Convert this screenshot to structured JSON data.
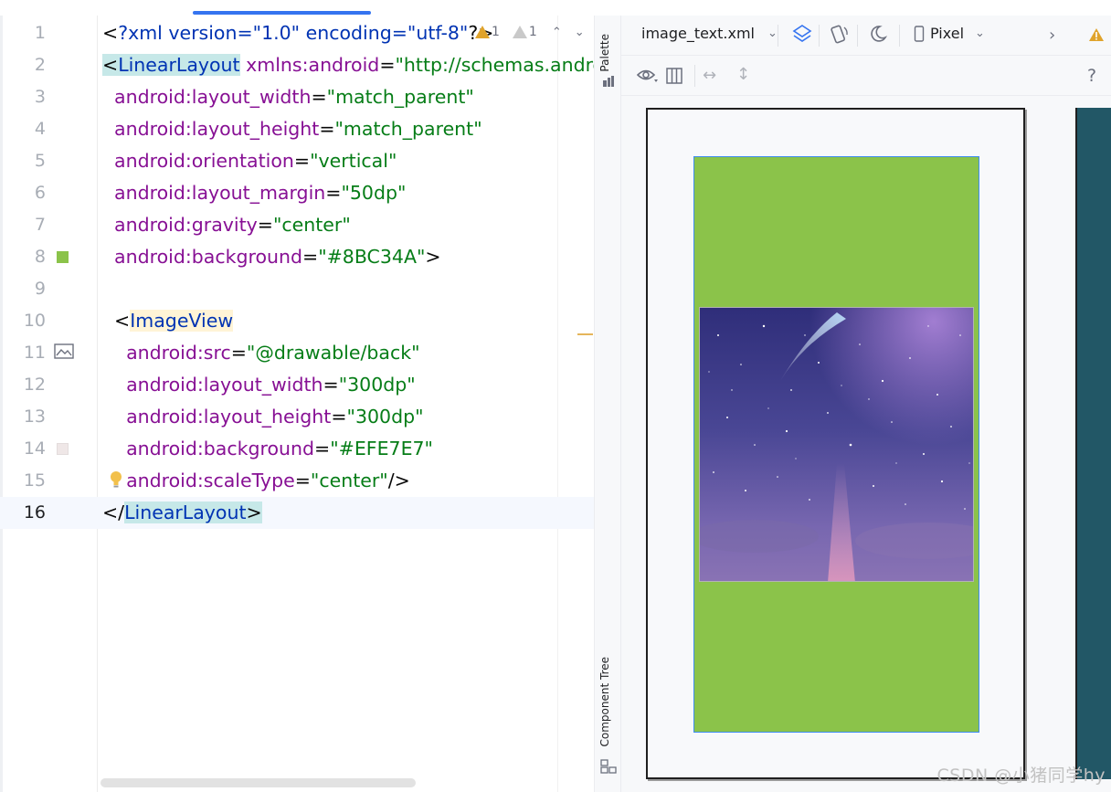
{
  "editor": {
    "tab_fragments": [
      "",
      "",
      ""
    ],
    "inspection": {
      "warnings_count": "1",
      "weak_warnings_count": "1"
    },
    "lines": [
      {
        "number": "1",
        "tokens": [
          [
            "punc",
            "<"
          ],
          [
            "xmldecl",
            "?xml version=\"1.0\" encoding=\"utf-8\""
          ],
          [
            "punc",
            "?>"
          ]
        ]
      },
      {
        "number": "2",
        "tokens": [
          [
            "punc-hl",
            "<"
          ],
          [
            "tag-hl",
            "LinearLayout"
          ],
          [
            "plain",
            " "
          ],
          [
            "attr",
            "xmlns:android"
          ],
          [
            "punc",
            "="
          ],
          [
            "val",
            "\"http://schemas.androi"
          ]
        ]
      },
      {
        "number": "3",
        "tokens": [
          [
            "plain",
            "  "
          ],
          [
            "attr",
            "android:layout_width"
          ],
          [
            "punc",
            "="
          ],
          [
            "val",
            "\"match_parent\""
          ]
        ]
      },
      {
        "number": "4",
        "tokens": [
          [
            "plain",
            "  "
          ],
          [
            "attr",
            "android:layout_height"
          ],
          [
            "punc",
            "="
          ],
          [
            "val",
            "\"match_parent\""
          ]
        ]
      },
      {
        "number": "5",
        "tokens": [
          [
            "plain",
            "  "
          ],
          [
            "attr",
            "android:orientation"
          ],
          [
            "punc",
            "="
          ],
          [
            "val",
            "\"vertical\""
          ]
        ]
      },
      {
        "number": "6",
        "tokens": [
          [
            "plain",
            "  "
          ],
          [
            "attr",
            "android:layout_margin"
          ],
          [
            "punc",
            "="
          ],
          [
            "val",
            "\"50dp\""
          ]
        ]
      },
      {
        "number": "7",
        "tokens": [
          [
            "plain",
            "  "
          ],
          [
            "attr",
            "android:gravity"
          ],
          [
            "punc",
            "="
          ],
          [
            "val",
            "\"center\""
          ]
        ]
      },
      {
        "number": "8",
        "tokens": [
          [
            "plain",
            "  "
          ],
          [
            "attr",
            "android:background"
          ],
          [
            "punc",
            "="
          ],
          [
            "val",
            "\"#8BC34A\""
          ],
          [
            "punc",
            ">"
          ]
        ]
      },
      {
        "number": "9",
        "tokens": []
      },
      {
        "number": "10",
        "tokens": [
          [
            "plain",
            "  "
          ],
          [
            "punc",
            "<"
          ],
          [
            "tag-y",
            "ImageView"
          ]
        ]
      },
      {
        "number": "11",
        "tokens": [
          [
            "plain",
            "    "
          ],
          [
            "attr",
            "android:src"
          ],
          [
            "punc",
            "="
          ],
          [
            "val",
            "\"@drawable/back\""
          ]
        ]
      },
      {
        "number": "12",
        "tokens": [
          [
            "plain",
            "    "
          ],
          [
            "attr",
            "android:layout_width"
          ],
          [
            "punc",
            "="
          ],
          [
            "val",
            "\"300dp\""
          ]
        ]
      },
      {
        "number": "13",
        "tokens": [
          [
            "plain",
            "    "
          ],
          [
            "attr",
            "android:layout_height"
          ],
          [
            "punc",
            "="
          ],
          [
            "val",
            "\"300dp\""
          ]
        ]
      },
      {
        "number": "14",
        "tokens": [
          [
            "plain",
            "    "
          ],
          [
            "attr",
            "android:background"
          ],
          [
            "punc",
            "="
          ],
          [
            "val",
            "\"#EFE7E7\""
          ]
        ]
      },
      {
        "number": "15",
        "tokens": [
          [
            "plain",
            "    "
          ],
          [
            "attr",
            "android:scaleType"
          ],
          [
            "punc",
            "="
          ],
          [
            "val",
            "\"center\""
          ],
          [
            "punc",
            "/>"
          ]
        ]
      },
      {
        "number": "16",
        "tokens": [
          [
            "punc",
            "</"
          ],
          [
            "tag-hl",
            "LinearLayout"
          ],
          [
            "punc-hl",
            ">"
          ]
        ]
      }
    ],
    "current_line": "16",
    "gutter_markers": {
      "line_8_color": "#8BC34A",
      "line_14_color": "#EFE7E7"
    }
  },
  "side_strip": {
    "palette_label": "Palette",
    "component_tree_label": "Component Tree"
  },
  "designer": {
    "file_name": "image_text.xml",
    "device_label": "Pixel",
    "help_label": "?",
    "layout_background": "#8BC34A"
  },
  "watermark": "CSDN @小猪同学hy",
  "colors": {
    "accent_blue": "#3574F0",
    "warning": "#E0A32B",
    "device_alt_bg": "#225766"
  }
}
